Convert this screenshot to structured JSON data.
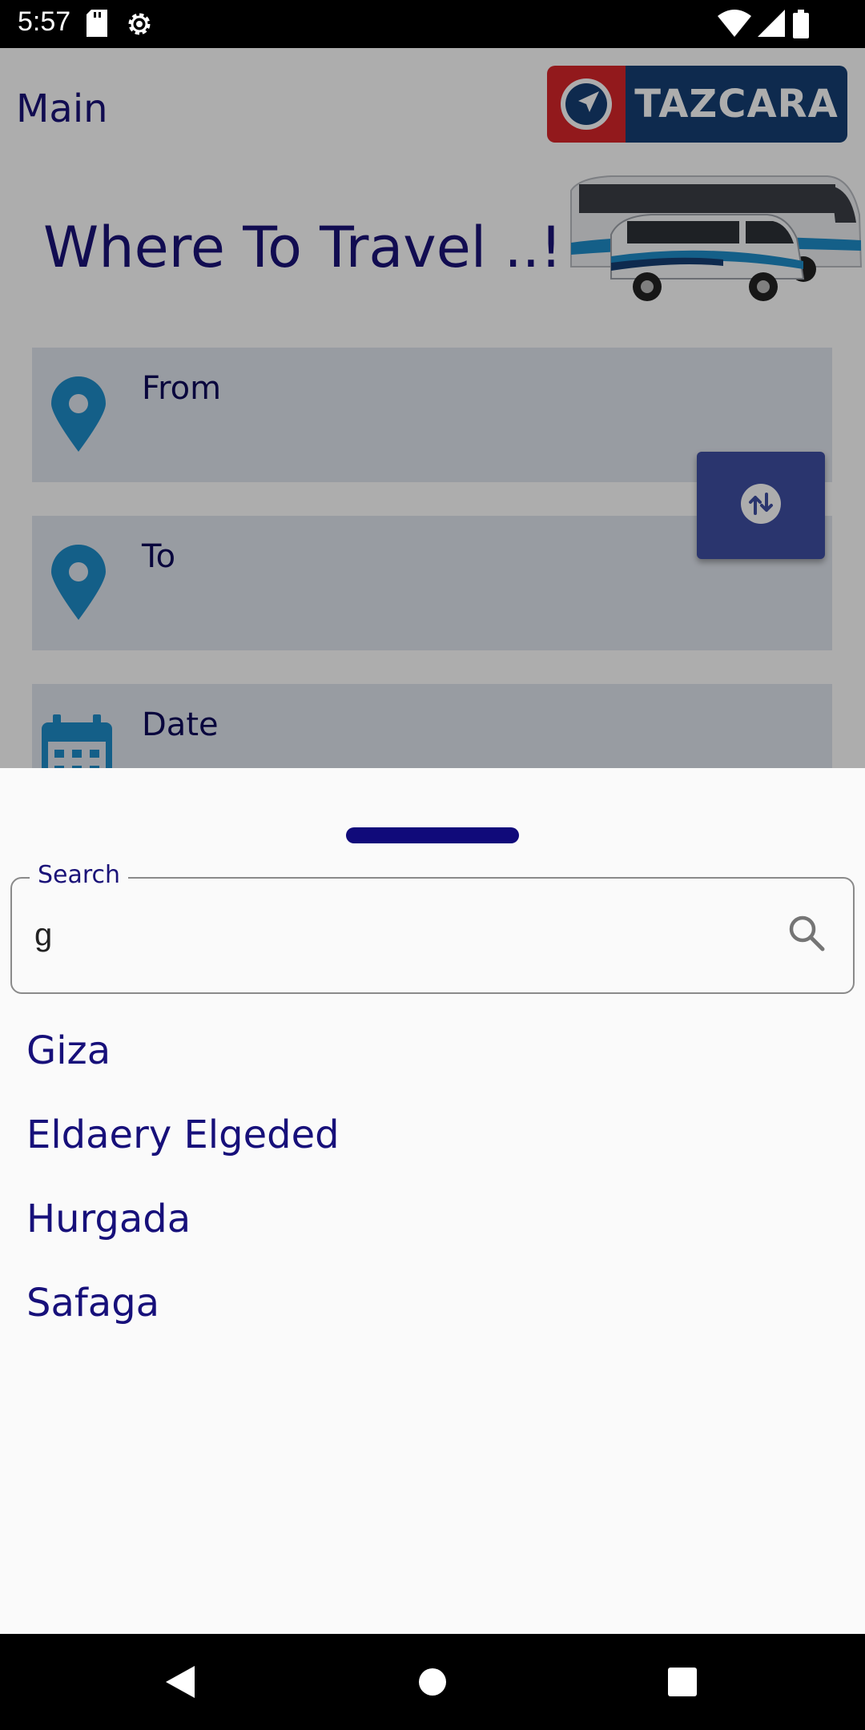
{
  "status_bar": {
    "time": "5:57",
    "icons": [
      "sd-card-icon",
      "settings-gear-icon",
      "wifi-icon",
      "signal-icon",
      "battery-icon"
    ]
  },
  "page": {
    "nav_title": "Main",
    "logo_text": "TAZCARA",
    "hero_title": "Where To Travel ..!",
    "fields": {
      "from_label": "From",
      "to_label": "To",
      "date_label": "Date"
    }
  },
  "sheet": {
    "search_label": "Search",
    "search_value": "g",
    "results": [
      "Giza",
      "Eldaery Elgeded",
      "Hurgada",
      "Safaga"
    ]
  },
  "colors": {
    "brand_navy": "#1a1278",
    "logo_red": "#d8252a",
    "logo_blue": "#163f73",
    "swap_button": "#3f4ea2",
    "pin_blue": "#1e8cc9"
  }
}
